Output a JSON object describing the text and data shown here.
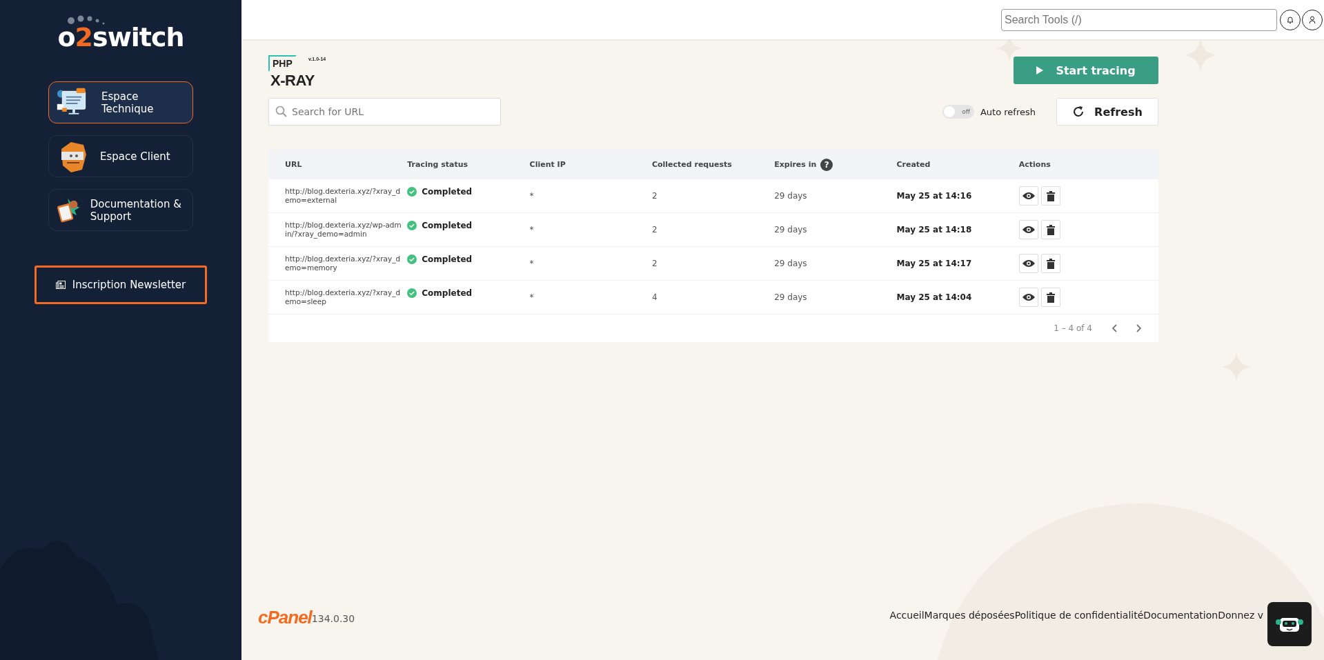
{
  "sidebar": {
    "logo": "o**2**switch",
    "items": [
      {
        "label": "Espace Technique",
        "kind": "technique",
        "selected": true
      },
      {
        "label": "Espace Client",
        "kind": "client",
        "selected": false
      },
      {
        "label": "Documentation & Support",
        "kind": "documentation",
        "selected": false
      }
    ],
    "newsletter_button": "Inscription Newsletter"
  },
  "header": {
    "search": {
      "placeholder": "Search Tools (/)"
    }
  },
  "xray": {
    "logo_top": "PHP",
    "logo_main": "X-RAY",
    "version": "v.1.0-14",
    "start_button": "Start tracing",
    "search": {
      "placeholder": "Search for URL"
    },
    "auto_refresh": {
      "on": false,
      "switch_text": "off",
      "label": "Auto refresh"
    },
    "refresh_button": "Refresh",
    "table": {
      "columns": [
        {
          "label": "URL"
        },
        {
          "label": "Tracing status"
        },
        {
          "label": "Client IP"
        },
        {
          "label": "Collected requests"
        },
        {
          "label": "Expires in",
          "help": "?"
        },
        {
          "label": "Created"
        },
        {
          "label": "Actions"
        }
      ],
      "rows": [
        {
          "url": "http://blog.dexteria.xyz/?xray_demo=external",
          "status": "Completed",
          "client_ip": "*",
          "requests": "2",
          "expires": "29 days",
          "created": "May 25 at 14:16"
        },
        {
          "url": "http://blog.dexteria.xyz/wp-admin/?xray_demo=admin",
          "status": "Completed",
          "client_ip": "*",
          "requests": "2",
          "expires": "29 days",
          "created": "May 25 at 14:18"
        },
        {
          "url": "http://blog.dexteria.xyz/?xray_demo=memory",
          "status": "Completed",
          "client_ip": "*",
          "requests": "2",
          "expires": "29 days",
          "created": "May 25 at 14:17"
        },
        {
          "url": "http://blog.dexteria.xyz/?xray_demo=sleep",
          "status": "Completed",
          "client_ip": "*",
          "requests": "4",
          "expires": "29 days",
          "created": "May 25 at 14:04"
        }
      ],
      "pagination": "1 – 4 of 4"
    }
  },
  "footer": {
    "cpanel_logo": "cPanel",
    "version": "134.0.30",
    "links": [
      "Accueil",
      "Marques déposées",
      "Politique de confidentialité",
      "Documentation",
      "Donnez v"
    ]
  }
}
